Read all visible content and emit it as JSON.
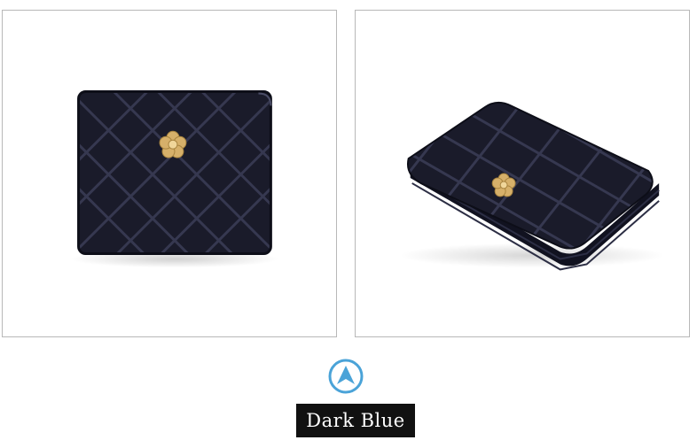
{
  "product": {
    "color_label": "Dark Blue",
    "accent_color": "#4aa3d8",
    "wallet_color": "#1a1b2a",
    "hardware_color": "#d6b06a"
  },
  "views": [
    {
      "name": "front-view",
      "icon": "wallet-front-photo"
    },
    {
      "name": "angled-view",
      "icon": "wallet-angled-photo"
    }
  ],
  "badge": {
    "icon": "up-arrow-icon"
  }
}
